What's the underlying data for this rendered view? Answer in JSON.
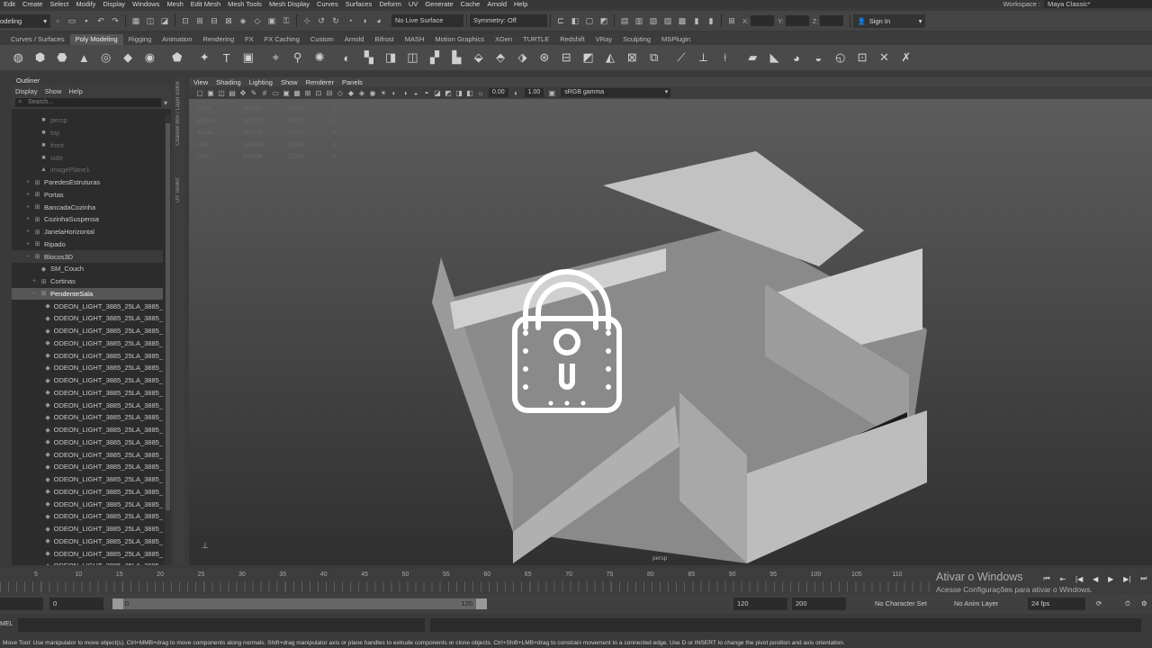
{
  "menubar": {
    "items": [
      "Edit",
      "Create",
      "Select",
      "Modify",
      "Display",
      "Windows",
      "Mesh",
      "Edit Mesh",
      "Mesh Tools",
      "Mesh Display",
      "Curves",
      "Surfaces",
      "Deform",
      "UV",
      "Generate",
      "Cache",
      "Arnold",
      "Help"
    ],
    "workspace_label": "Workspace :",
    "workspace_value": "Maya Classic*"
  },
  "statusline": {
    "mode": "odeling",
    "live_surface": "No Live Surface",
    "symmetry": "Symmetry: Off",
    "x_label": "X:",
    "y_label": "Y:",
    "z_label": "Z:",
    "sign_in": "Sign In"
  },
  "shelf_tabs": [
    "Curves / Surfaces",
    "Poly Modeling",
    "Rigging",
    "Animation",
    "Rendering",
    "FX",
    "FX Caching",
    "Custom",
    "Arnold",
    "Bifrost",
    "MASH",
    "Motion Graphics",
    "XGen",
    "TURTLE",
    "Redshift",
    "VRay",
    "Sculpting",
    "MSPlugin"
  ],
  "shelf_active_index": 1,
  "outliner": {
    "title": "Outliner",
    "menu": [
      "Display",
      "Show",
      "Help"
    ],
    "search_placeholder": "Search...",
    "rows": [
      {
        "label": "persp",
        "icon": "camera-icon",
        "indent": 2,
        "dim": true,
        "expand": ""
      },
      {
        "label": "top",
        "icon": "camera-icon",
        "indent": 2,
        "dim": true,
        "expand": ""
      },
      {
        "label": "front",
        "icon": "camera-icon",
        "indent": 2,
        "dim": true,
        "expand": ""
      },
      {
        "label": "side",
        "icon": "camera-icon",
        "indent": 2,
        "dim": true,
        "expand": ""
      },
      {
        "label": "imagePlane1",
        "icon": "image-plane-icon",
        "indent": 2,
        "dim": true,
        "expand": ""
      },
      {
        "label": "ParedesEstruturas",
        "icon": "group-icon",
        "indent": 1,
        "dim": false,
        "expand": "+"
      },
      {
        "label": "Portas",
        "icon": "group-icon",
        "indent": 1,
        "dim": false,
        "expand": "+"
      },
      {
        "label": "BancadaCozinha",
        "icon": "group-icon",
        "indent": 1,
        "dim": false,
        "expand": "+"
      },
      {
        "label": "CozinhaSuspensa",
        "icon": "group-icon",
        "indent": 1,
        "dim": false,
        "expand": "+"
      },
      {
        "label": "JanelaHorizontal",
        "icon": "group-icon",
        "indent": 1,
        "dim": false,
        "expand": "+"
      },
      {
        "label": "Ripado",
        "icon": "group-icon",
        "indent": 1,
        "dim": false,
        "expand": "+"
      },
      {
        "label": "Blocos3D",
        "icon": "group-icon",
        "indent": 1,
        "dim": false,
        "expand": "−",
        "hl": true
      },
      {
        "label": "SM_Couch",
        "icon": "mesh-icon",
        "indent": 2,
        "dim": false,
        "expand": ""
      },
      {
        "label": "Cortinas",
        "icon": "group-icon",
        "indent": 2,
        "dim": false,
        "expand": "+"
      },
      {
        "label": "PendenteSala",
        "icon": "group-icon",
        "indent": 2,
        "dim": false,
        "expand": "−",
        "sel": true
      },
      {
        "label": "ODEON_LIGHT_3885_25LA_3885_",
        "icon": "mesh-icon",
        "indent": 3,
        "dim": false,
        "expand": ""
      },
      {
        "label": "ODEON_LIGHT_3885_25LA_3885_",
        "icon": "mesh-icon",
        "indent": 3,
        "dim": false,
        "expand": ""
      },
      {
        "label": "ODEON_LIGHT_3885_25LA_3885_",
        "icon": "mesh-icon",
        "indent": 3,
        "dim": false,
        "expand": ""
      },
      {
        "label": "ODEON_LIGHT_3885_25LA_3885_",
        "icon": "mesh-icon",
        "indent": 3,
        "dim": false,
        "expand": ""
      },
      {
        "label": "ODEON_LIGHT_3885_25LA_3885_",
        "icon": "mesh-icon",
        "indent": 3,
        "dim": false,
        "expand": ""
      },
      {
        "label": "ODEON_LIGHT_3885_25LA_3885_",
        "icon": "mesh-icon",
        "indent": 3,
        "dim": false,
        "expand": ""
      },
      {
        "label": "ODEON_LIGHT_3885_25LA_3885_",
        "icon": "mesh-icon",
        "indent": 3,
        "dim": false,
        "expand": ""
      },
      {
        "label": "ODEON_LIGHT_3885_25LA_3885_",
        "icon": "mesh-icon",
        "indent": 3,
        "dim": false,
        "expand": ""
      },
      {
        "label": "ODEON_LIGHT_3885_25LA_3885_",
        "icon": "mesh-icon",
        "indent": 3,
        "dim": false,
        "expand": ""
      },
      {
        "label": "ODEON_LIGHT_3885_25LA_3885_",
        "icon": "mesh-icon",
        "indent": 3,
        "dim": false,
        "expand": ""
      },
      {
        "label": "ODEON_LIGHT_3885_25LA_3885_",
        "icon": "mesh-icon",
        "indent": 3,
        "dim": false,
        "expand": ""
      },
      {
        "label": "ODEON_LIGHT_3885_25LA_3885_",
        "icon": "mesh-icon",
        "indent": 3,
        "dim": false,
        "expand": ""
      },
      {
        "label": "ODEON_LIGHT_3885_25LA_3885_",
        "icon": "mesh-icon",
        "indent": 3,
        "dim": false,
        "expand": ""
      },
      {
        "label": "ODEON_LIGHT_3885_25LA_3885_",
        "icon": "mesh-icon",
        "indent": 3,
        "dim": false,
        "expand": ""
      },
      {
        "label": "ODEON_LIGHT_3885_25LA_3885_",
        "icon": "mesh-icon",
        "indent": 3,
        "dim": false,
        "expand": ""
      },
      {
        "label": "ODEON_LIGHT_3885_25LA_3885_",
        "icon": "mesh-icon",
        "indent": 3,
        "dim": false,
        "expand": ""
      },
      {
        "label": "ODEON_LIGHT_3885_25LA_3885_",
        "icon": "mesh-icon",
        "indent": 3,
        "dim": false,
        "expand": ""
      },
      {
        "label": "ODEON_LIGHT_3885_25LA_3885_",
        "icon": "mesh-icon",
        "indent": 3,
        "dim": false,
        "expand": ""
      },
      {
        "label": "ODEON_LIGHT_3885_25LA_3885_",
        "icon": "mesh-icon",
        "indent": 3,
        "dim": false,
        "expand": ""
      },
      {
        "label": "ODEON_LIGHT_3885_25LA_3885_",
        "icon": "mesh-icon",
        "indent": 3,
        "dim": false,
        "expand": ""
      },
      {
        "label": "ODEON_LIGHT_3885_25LA_3885_",
        "icon": "mesh-icon",
        "indent": 3,
        "dim": false,
        "expand": ""
      },
      {
        "label": "ODEON_LIGHT_3885_25LA_3885_",
        "icon": "mesh-icon",
        "indent": 3,
        "dim": false,
        "expand": ""
      }
    ]
  },
  "side_tabs": [
    "Channel Box / Layer Editor",
    "UV Toolkit"
  ],
  "viewport": {
    "menu": [
      "View",
      "Shading",
      "Lighting",
      "Show",
      "Renderer",
      "Panels"
    ],
    "exposure": "0.00",
    "gamma": "1.00",
    "color_space": "sRGB gamma",
    "camera": "persp",
    "hud": [
      [
        "Verts:",
        "392169",
        "35090",
        "0"
      ],
      [
        "Edges:",
        "825778",
        "85732",
        "0"
      ],
      [
        "Faces:",
        "450573",
        "52067",
        "0"
      ],
      [
        "Tris:",
        "813469",
        "52789",
        "0"
      ],
      [
        "UVs:",
        "438039",
        "57200",
        "0"
      ]
    ]
  },
  "timeslider": {
    "ticks": [
      "5",
      "10",
      "15",
      "20",
      "25",
      "30",
      "35",
      "40",
      "45",
      "50",
      "55",
      "60",
      "65",
      "70",
      "75",
      "80",
      "85",
      "90",
      "95",
      "100",
      "105",
      "110"
    ],
    "current_frame": "1"
  },
  "range": {
    "start": "0",
    "inner_start": "0",
    "inner_end": "120",
    "end": "120",
    "max": "200",
    "character_set": "No Character Set",
    "anim_layer": "No Anim Layer",
    "fps": "24 fps"
  },
  "cmdline": {
    "label": "MEL"
  },
  "help_line": "Move Tool: Use manipulator to move object(s). Ctrl+MMB+drag to move components along normals. Shift+drag manipulator axis or plane handles to extrude components or clone objects. Ctrl+Shift+LMB+drag to constrain movement to a connected edge. Use D or INSERT to change the pivot position and axis orientation.",
  "watermark": {
    "line1": "Ativar o Windows",
    "line2": "Acesse Configurações para ativar o Windows."
  },
  "colors": {
    "selection": "#565656",
    "background": "#3a3a3a"
  }
}
